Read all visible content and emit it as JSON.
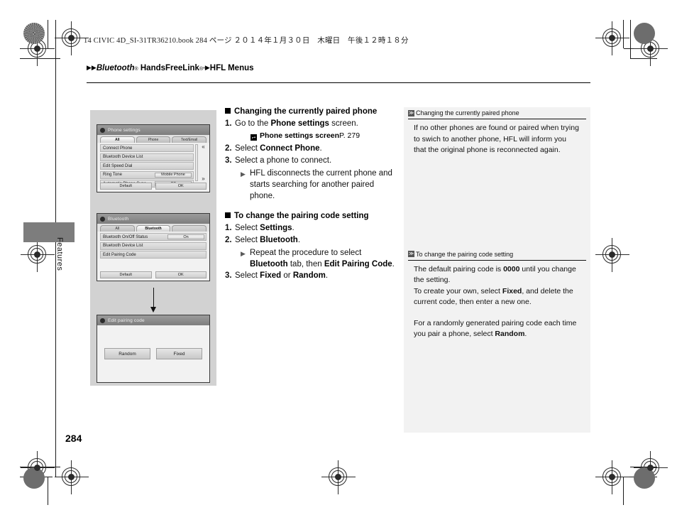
{
  "header": {
    "book_line": "14 CIVIC 4D_SI-31TR36210.book   284 ページ   ２０１４年１月３０日　木曜日　午後１２時１８分",
    "breadcrumb": {
      "arrow1": "▶",
      "arrow2": "▶",
      "bluetooth": "Bluetooth",
      "bluetooth_sup": "®",
      "handsfreelink": "HandsFreeLink",
      "handsfreelink_sup": "®*",
      "arrow3": "▶",
      "section": "HFL Menus"
    }
  },
  "side_tab": {
    "label": "Features"
  },
  "page_number": "284",
  "illustrations": {
    "screen1": {
      "title": "Phone settings",
      "tabs": [
        "All",
        "Phone",
        "Text/Email"
      ],
      "active_tab": "All",
      "rows": [
        {
          "label": "Connect Phone",
          "value": ""
        },
        {
          "label": "Bluetooth Device List",
          "value": ""
        },
        {
          "label": "Edit Speed Dial",
          "value": ""
        },
        {
          "label": "Ring Tone",
          "value": "Mobile Phone"
        },
        {
          "label": "Automatic Phone Sync",
          "value": "Off"
        }
      ],
      "scroll_up": "«",
      "scroll_down": "»",
      "buttons": [
        "Default",
        "OK"
      ]
    },
    "screen2": {
      "title": "Bluetooth",
      "tabs": [
        "All",
        "Bluetooth",
        ""
      ],
      "active_tab": "Bluetooth",
      "rows": [
        {
          "label": "Bluetooth On/Off Status",
          "value": "On"
        },
        {
          "label": "Bluetooth Device List",
          "value": ""
        },
        {
          "label": "Edit Pairing Code",
          "value": ""
        }
      ],
      "buttons": [
        "Default",
        "OK"
      ]
    },
    "screen3": {
      "title": "Edit pairing code",
      "buttons": [
        "Random",
        "Fixed"
      ]
    },
    "flow_arrow": "down-arrow"
  },
  "main": {
    "section1": {
      "heading": "Changing the currently paired phone",
      "steps": [
        {
          "num": "1.",
          "pre": "Go to the ",
          "bold": "Phone settings",
          "post": " screen."
        },
        {
          "num": "2.",
          "pre": "Select ",
          "bold": "Connect Phone",
          "post": "."
        },
        {
          "num": "3.",
          "pre": "Select a phone to connect.",
          "bold": "",
          "post": ""
        }
      ],
      "reference": {
        "mark": "⮣",
        "label": "Phone settings screen",
        "page": " P. 279"
      },
      "bullet": {
        "marker": "▶",
        "text": "HFL disconnects the current phone and starts searching for another paired phone."
      }
    },
    "section2": {
      "heading": "To change the pairing code setting",
      "steps": [
        {
          "num": "1.",
          "pre": "Select ",
          "bold": "Settings",
          "post": "."
        },
        {
          "num": "2.",
          "pre": "Select ",
          "bold": "Bluetooth",
          "post": "."
        }
      ],
      "bullet": {
        "marker": "▶",
        "pre": "Repeat the procedure to select ",
        "bold1": "Bluetooth",
        "mid": " tab, then ",
        "bold2": "Edit Pairing Code",
        "post": "."
      },
      "step3": {
        "num": "3.",
        "pre": "Select ",
        "bold1": "Fixed",
        "mid": " or ",
        "bold2": "Random",
        "post": "."
      }
    }
  },
  "notes": {
    "note1": {
      "marker": "≫",
      "heading": "Changing the currently paired phone",
      "body": "If no other phones are found or paired when trying to swich to another phone, HFL will inform you that the original phone is reconnected again."
    },
    "note2": {
      "marker": "≫",
      "heading": "To change the pairing code setting",
      "para1_pre": "The default pairing code is ",
      "para1_bold": "0000",
      "para1_post": " until you change the setting.",
      "para2_pre": "To create your own, select ",
      "para2_bold": "Fixed",
      "para2_post": ", and delete the current code, then enter a new one.",
      "para3_pre": "For a randomly generated pairing code each time you pair a phone, select ",
      "para3_bold": "Random",
      "para3_post": "."
    }
  },
  "colors": {
    "note_bg": "#f2f2f2",
    "illus_bg": "#d2d2d2",
    "side_tab": "#7d7d7d"
  }
}
